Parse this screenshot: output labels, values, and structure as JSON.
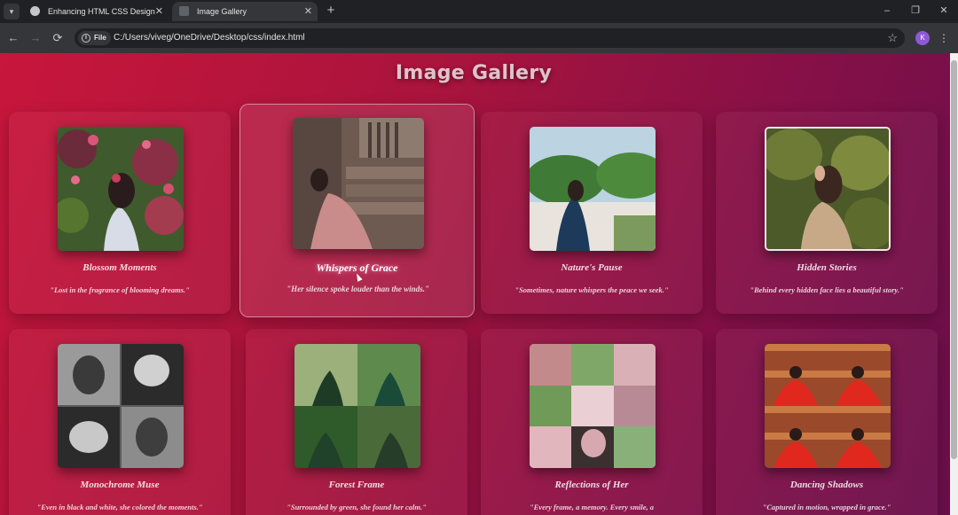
{
  "browser": {
    "tabs": [
      {
        "title": "Enhancing HTML CSS Design",
        "active": false
      },
      {
        "title": "Image Gallery",
        "active": true
      }
    ],
    "new_tab": "+",
    "window_controls": {
      "minimize": "–",
      "restore": "❐",
      "close": "✕"
    },
    "nav": {
      "back": "←",
      "forward": "→",
      "reload": "⟳"
    },
    "address": {
      "scheme_chip": "File",
      "url": "C:/Users/viveg/OneDrive/Desktop/css/index.html"
    },
    "bookmark_icon": "☆",
    "profile_initial": "K",
    "menu_icon": "⋮"
  },
  "page": {
    "title": "Image Gallery",
    "accent_colors": {
      "gradient_start": "#c8163c",
      "gradient_end": "#6a0e4b"
    }
  },
  "gallery": [
    {
      "title": "Blossom Moments",
      "caption": "\"Lost in the fragrance of blooming dreams.\"",
      "photo": "woman-among-flowers",
      "hovered": false
    },
    {
      "title": "Whispers of Grace",
      "caption": "\"Her silence spoke louder than the winds.\"",
      "photo": "woman-seated-on-steps",
      "hovered": true
    },
    {
      "title": "Nature's Pause",
      "caption": "\"Sometimes, nature whispers the peace we seek.\"",
      "photo": "woman-on-terrace",
      "hovered": false
    },
    {
      "title": "Hidden Stories",
      "caption": "\"Behind every hidden face lies a beautiful story.\"",
      "photo": "woman-hiding-face",
      "hovered": false
    },
    {
      "title": "Monochrome Muse",
      "caption": "\"Even in black and white, she colored the moments.\"",
      "photo": "black-and-white-collage",
      "hovered": false
    },
    {
      "title": "Forest Frame",
      "caption": "\"Surrounded by green, she found her calm.\"",
      "photo": "green-saree-collage",
      "hovered": false
    },
    {
      "title": "Reflections of Her",
      "caption": "\"Every frame, a memory. Every smile, a",
      "photo": "pastel-collage",
      "hovered": false
    },
    {
      "title": "Dancing Shadows",
      "caption": "\"Captured in motion, wrapped in grace.\"",
      "photo": "red-dress-collage",
      "hovered": false
    }
  ]
}
